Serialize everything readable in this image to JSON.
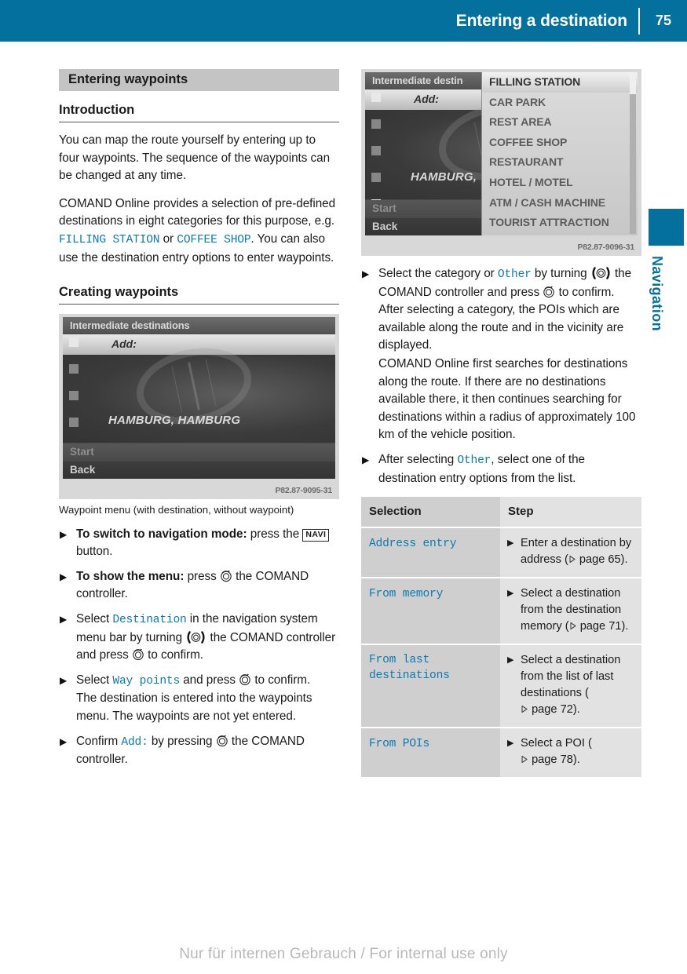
{
  "header": {
    "title": "Entering a destination",
    "page_number": "75",
    "accent_color": "#04709E"
  },
  "side_tab": {
    "label": "Navigation"
  },
  "left_column": {
    "section_band": "Entering waypoints",
    "intro_heading": "Introduction",
    "intro_paragraph_1": "You can map the route yourself by entering up to four waypoints. The sequence of the waypoints can be changed at any time.",
    "intro_p2_a": "COMAND Online provides a selection of pre-defined destinations in eight categories for this purpose, e.g. ",
    "intro_p2_mono1": "FILLING STATION",
    "intro_p2_b": " or ",
    "intro_p2_mono2": "COFFEE SHOP",
    "intro_p2_c": ". You can also use the destination entry options to enter waypoints.",
    "creating_heading": "Creating waypoints",
    "screenshot": {
      "titlebar": "Intermediate destinations",
      "add_label": "Add:",
      "city": "HAMBURG, HAMBURG",
      "start_label": "Start",
      "back_label": "Back",
      "code": "P82.87-9095-31"
    },
    "figure_caption": "Waypoint menu (with destination, without waypoint)",
    "steps": [
      {
        "lead": "To switch to navigation mode:",
        "text_a": " press the ",
        "button": "NAVI",
        "text_b": " button."
      },
      {
        "lead": "To show the menu:",
        "text_a": " press ",
        "icon": "comand-press-icon",
        "text_b": " the COMAND controller."
      },
      {
        "text_a": "Select ",
        "mono": "Destination",
        "text_b": " in the navigation system menu bar by turning ",
        "icon_turn": "comand-turn-icon",
        "text_c": " the COMAND controller and press ",
        "icon_press": "comand-press-icon",
        "text_d": " to confirm."
      },
      {
        "text_a": "Select ",
        "mono": "Way points",
        "text_b": " and press ",
        "icon_press": "comand-press-icon",
        "text_c": " to confirm.",
        "continuation": "The destination is entered into the waypoints menu. The waypoints are not yet entered."
      },
      {
        "text_a": "Confirm ",
        "mono": "Add:",
        "text_b": " by pressing ",
        "icon_press": "comand-press-icon",
        "text_c": " the COMAND controller."
      }
    ]
  },
  "right_column": {
    "screenshot": {
      "titlebar": "Intermediate destin",
      "add_label": "Add:",
      "city": "HAMBURG, ",
      "start_label": "Start",
      "back_label": "Back",
      "code": "P82.87-9096-31",
      "poi_categories": [
        "FILLING STATION",
        "CAR PARK",
        "REST AREA",
        "COFFEE SHOP",
        "RESTAURANT",
        "HOTEL / MOTEL",
        "ATM / CASH MACHINE",
        "TOURIST ATTRACTION"
      ],
      "poi_selected_index": 0
    },
    "steps": [
      {
        "text_a": "Select the category or ",
        "mono": "Other",
        "text_b": " by turning ",
        "icon_turn": "comand-turn-icon",
        "text_c": " the COMAND controller and press ",
        "icon_press": "comand-press-icon",
        "text_d": " to confirm.",
        "continuation_1": "After selecting a category, the POIs which are available along the route and in the vicinity are displayed.",
        "continuation_2": "COMAND Online first searches for destinations along the route. If there are no destinations available there, it then continues searching for destinations within a radius of approximately 100 km of the vehicle position."
      },
      {
        "text_a": "After selecting ",
        "mono": "Other",
        "text_b": ", select one of the destination entry options from the list."
      }
    ],
    "table": {
      "headers": [
        "Selection",
        "Step"
      ],
      "rows": [
        {
          "selection": "Address entry",
          "step_text": "Enter a destination by address (",
          "step_page": "page 65",
          "step_tail": ")."
        },
        {
          "selection": "From memory",
          "step_text": "Select a destination from the destination memory (",
          "step_page": "page 71",
          "step_tail": ")."
        },
        {
          "selection": "From last destinations",
          "step_text": "Select a destination from the list of last destinations (",
          "step_page": "page 72",
          "step_tail": ")."
        },
        {
          "selection": "From POIs",
          "step_text": "Select a POI (",
          "step_page": "page 78",
          "step_tail": ")."
        }
      ]
    }
  },
  "footer": {
    "stamp": "Nur für internen Gebrauch / For internal use only"
  }
}
